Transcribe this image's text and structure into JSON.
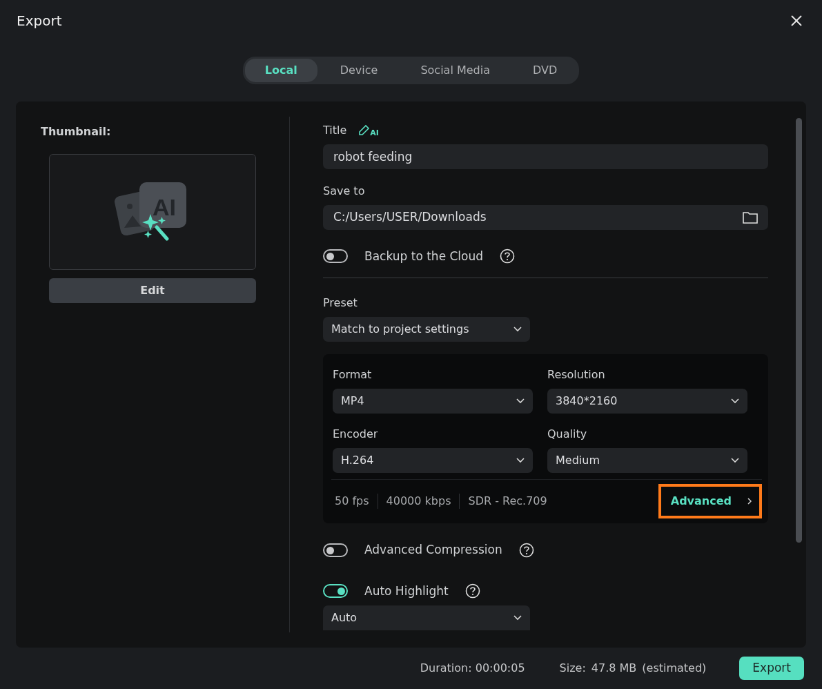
{
  "window": {
    "title": "Export"
  },
  "tabs": [
    {
      "label": "Local",
      "selected": true
    },
    {
      "label": "Device",
      "selected": false
    },
    {
      "label": "Social Media",
      "selected": false
    },
    {
      "label": "DVD",
      "selected": false
    }
  ],
  "thumbnail": {
    "label": "Thumbnail:",
    "badge_text": "AI",
    "edit_button": "Edit"
  },
  "title_field": {
    "label": "Title",
    "ai_tag": "AI",
    "value": "robot feeding"
  },
  "save_to": {
    "label": "Save to",
    "value": "C:/Users/USER/Downloads"
  },
  "backup": {
    "label": "Backup to the Cloud",
    "on": false
  },
  "preset": {
    "label": "Preset",
    "value": "Match to project settings"
  },
  "settings": [
    {
      "label": "Format",
      "value": "MP4"
    },
    {
      "label": "Resolution",
      "value": "3840*2160"
    },
    {
      "label": "Encoder",
      "value": "H.264"
    },
    {
      "label": "Quality",
      "value": "Medium"
    }
  ],
  "summary": [
    "50 fps",
    "40000 kbps",
    "SDR - Rec.709"
  ],
  "advanced": {
    "label": "Advanced",
    "highlighted": true
  },
  "toggles": [
    {
      "label": "Advanced Compression",
      "on": false
    },
    {
      "label": "Auto Highlight",
      "on": true
    }
  ],
  "highlight_mode": {
    "value": "Auto"
  },
  "footer": {
    "duration": "Duration: 00:00:05",
    "size_label": "Size:",
    "size": "47.8 MB",
    "size_note": "(estimated)",
    "export_button": "Export"
  }
}
